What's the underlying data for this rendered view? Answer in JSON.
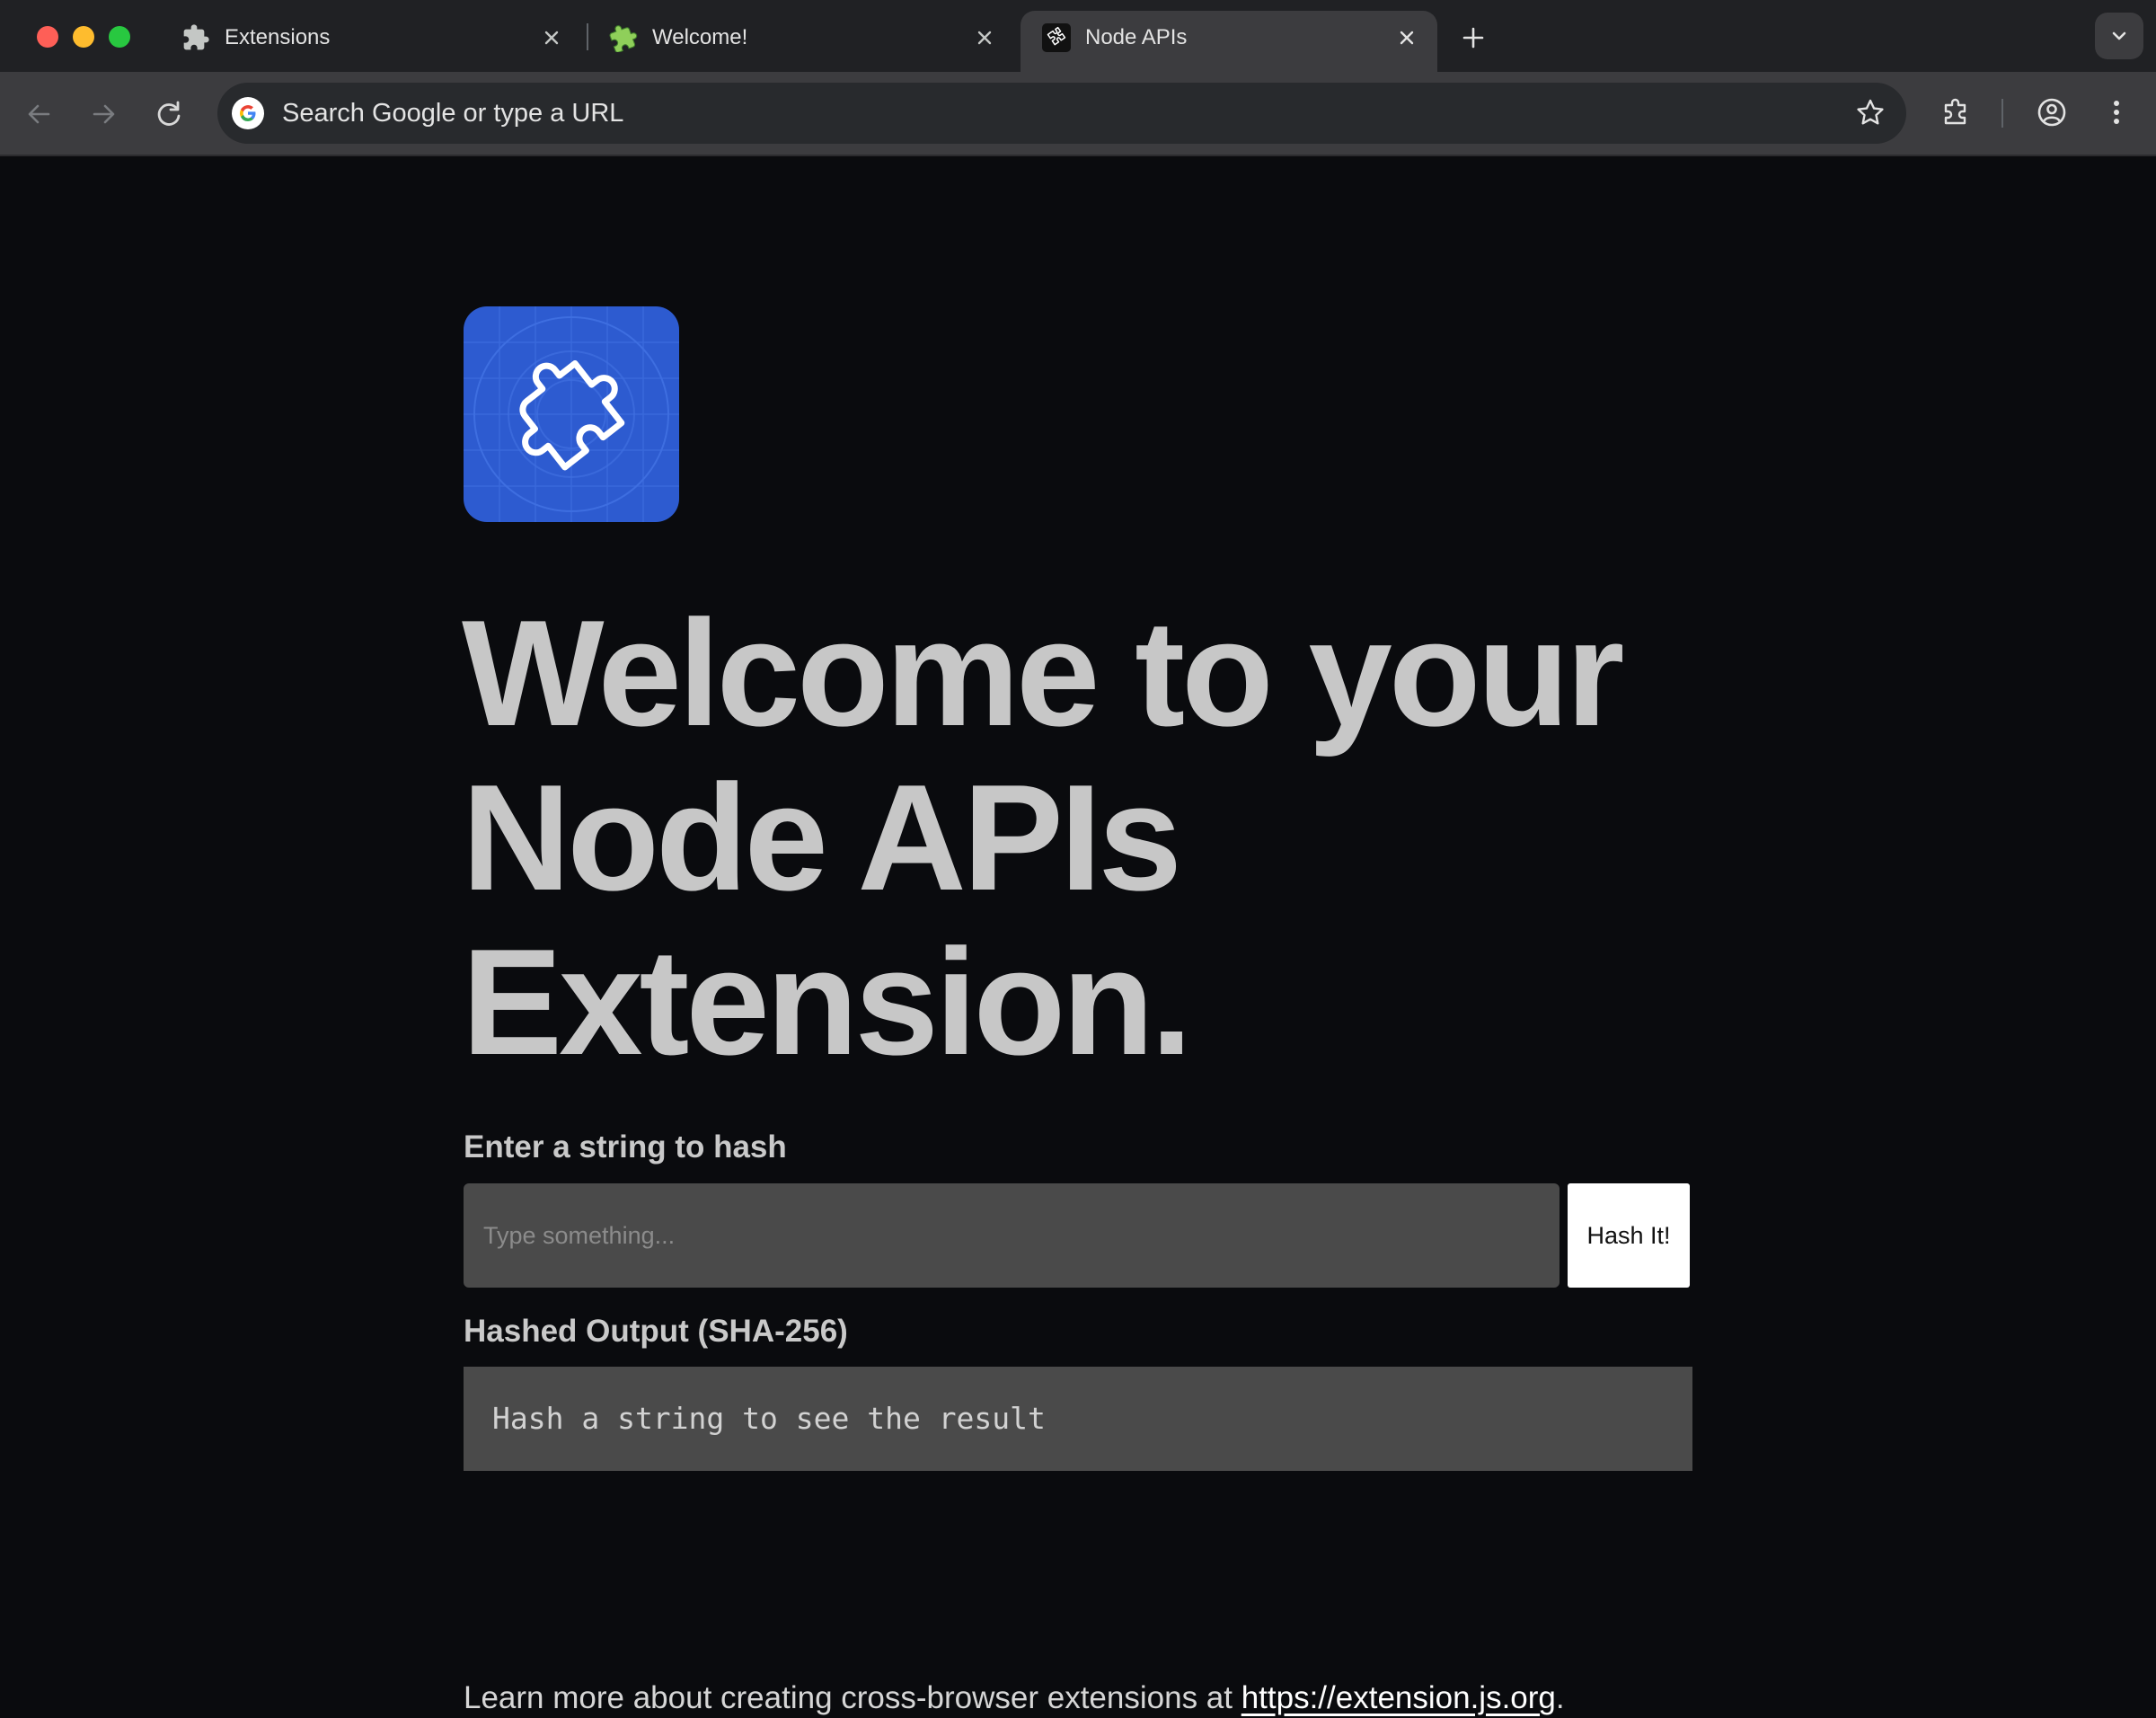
{
  "browser": {
    "tabs": [
      {
        "title": "Extensions",
        "icon": "puzzle-icon",
        "active": false
      },
      {
        "title": "Welcome!",
        "icon": "puzzle-green-icon",
        "active": false
      },
      {
        "title": "Node APIs",
        "icon": "puzzle-outline-icon",
        "active": true
      }
    ],
    "omnibox": {
      "placeholder": "Search Google or type a URL"
    }
  },
  "page": {
    "logo_icon": "puzzle-piece-logo",
    "headline": "Welcome to your Node APIs Extension.",
    "input_label": "Enter a string to hash",
    "input_placeholder": "Type something...",
    "button_label": "Hash It!",
    "output_label": "Hashed Output (SHA-256)",
    "output_text": "Hash a string to see the result",
    "footer_text": "Learn more about creating cross-browser extensions at ",
    "footer_link": "https://extension.js.org",
    "footer_end": "."
  },
  "colors": {
    "page_background": "#0a0b0e",
    "heading": "#c7c7c7",
    "logo_blue": "#2d5bd0",
    "field_background": "#4a4a4a"
  }
}
